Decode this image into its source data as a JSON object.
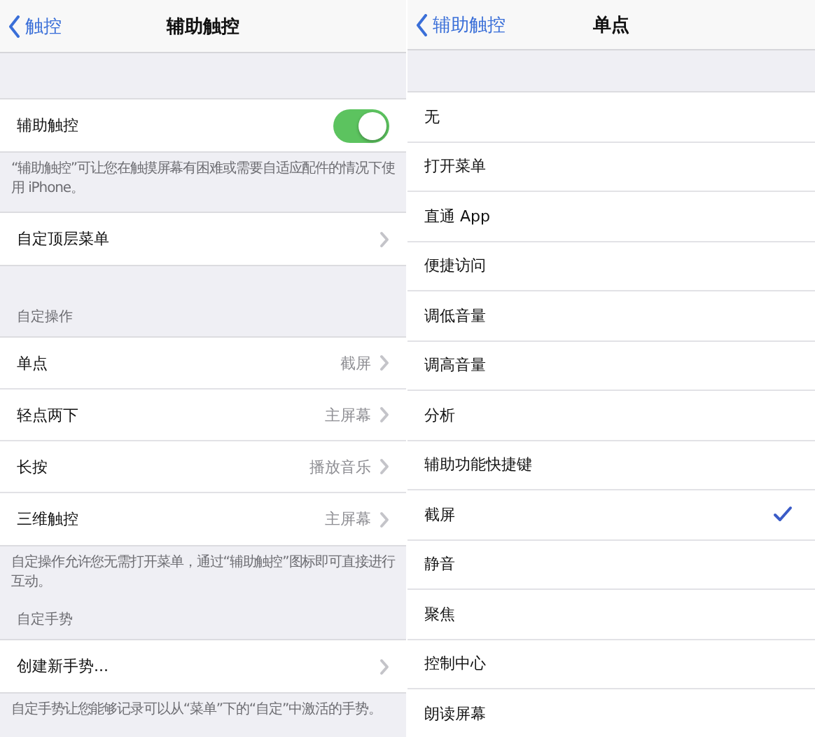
{
  "screens": [
    {
      "nav": {
        "back": "触控",
        "title": "辅助触控"
      },
      "groups": [
        {
          "rows": [
            {
              "kind": "toggle",
              "label": "辅助触控",
              "on": true
            }
          ],
          "footer": "“辅助触控”可让您在触摸屏幕有困难或需要自适应配件的情况下使用 iPhone。"
        },
        {
          "rows": [
            {
              "kind": "link",
              "label": "自定顶层菜单"
            }
          ]
        },
        {
          "header": "自定操作",
          "rows": [
            {
              "kind": "link",
              "label": "单点",
              "value": "截屏"
            },
            {
              "kind": "link",
              "label": "轻点两下",
              "value": "主屏幕"
            },
            {
              "kind": "link",
              "label": "长按",
              "value": "播放音乐"
            },
            {
              "kind": "link",
              "label": "三维触控",
              "value": "主屏幕"
            }
          ],
          "footer": "自定操作允许您无需打开菜单，通过“辅助触控”图标即可直接进行互动。"
        },
        {
          "header": "自定手势",
          "rows": [
            {
              "kind": "link",
              "label": "创建新手势..."
            }
          ],
          "footer": "自定手势让您能够记录可以从“菜单”下的“自定”中激活的手势。"
        }
      ]
    },
    {
      "nav": {
        "back": "辅助触控",
        "title": "单点"
      },
      "groups": [
        {
          "rows": [
            {
              "kind": "option",
              "label": "无",
              "selected": false
            },
            {
              "kind": "option",
              "label": "打开菜单",
              "selected": false
            },
            {
              "kind": "option",
              "label": "直通 App",
              "selected": false
            },
            {
              "kind": "option",
              "label": "便捷访问",
              "selected": false
            },
            {
              "kind": "option",
              "label": "调低音量",
              "selected": false
            },
            {
              "kind": "option",
              "label": "调高音量",
              "selected": false
            },
            {
              "kind": "option",
              "label": "分析",
              "selected": false
            },
            {
              "kind": "option",
              "label": "辅助功能快捷键",
              "selected": false
            },
            {
              "kind": "option",
              "label": "截屏",
              "selected": true
            },
            {
              "kind": "option",
              "label": "静音",
              "selected": false
            },
            {
              "kind": "option",
              "label": "聚焦",
              "selected": false
            },
            {
              "kind": "option",
              "label": "控制中心",
              "selected": false
            },
            {
              "kind": "option",
              "label": "朗读屏幕",
              "selected": false
            }
          ]
        }
      ]
    }
  ]
}
